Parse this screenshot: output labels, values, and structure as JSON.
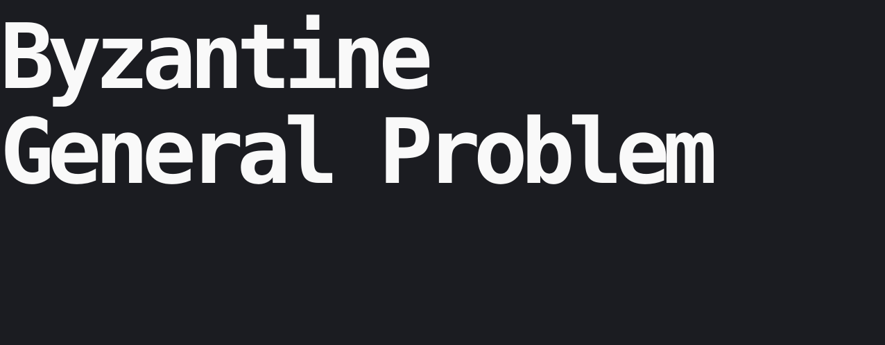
{
  "heading": {
    "line1": "Byzantine",
    "line2": "General Problem"
  },
  "colors": {
    "background": "#1b1c21",
    "text": "#f9f9f9"
  }
}
